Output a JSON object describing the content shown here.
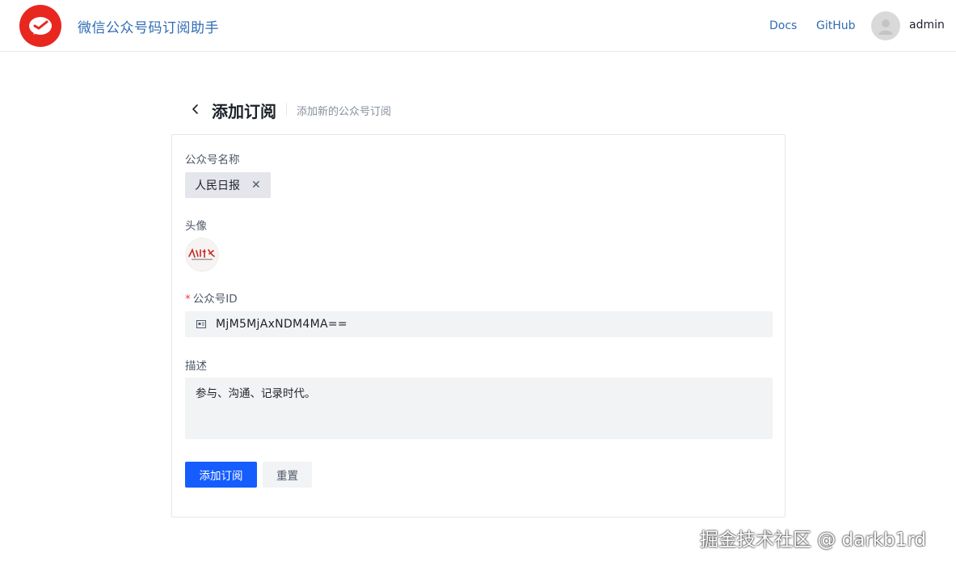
{
  "header": {
    "logo_icon": "red-envelope-logo-icon",
    "app_title": "微信公众号码订阅助手",
    "nav_docs": "Docs",
    "nav_github": "GitHub",
    "user_avatar_icon": "user-avatar-icon",
    "username": "admin"
  },
  "page": {
    "back_icon": "chevron-left-icon",
    "title": "添加订阅",
    "subtitle": "添加新的公众号订阅"
  },
  "form": {
    "name_label": "公众号名称",
    "name_tag": "人民日报",
    "avatar_label": "头像",
    "avatar_image": "人民日报",
    "id_label": "公众号ID",
    "id_required_mark": "*",
    "id_value": "MjM5MjAxNDM4MA==",
    "desc_label": "描述",
    "desc_value": "参与、沟通、记录时代。",
    "submit_button": "添加订阅",
    "reset_button": "重置"
  },
  "watermark": "掘金技术社区 @ darkb1rd",
  "colors": {
    "accent": "#165dff",
    "brand_red": "#e8271f",
    "link": "#2f6cb5"
  }
}
